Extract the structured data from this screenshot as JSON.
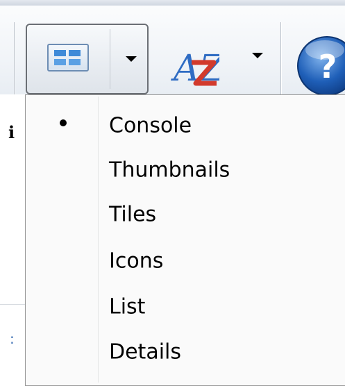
{
  "toolbar": {
    "view_button": {
      "icon": "views-icon",
      "arrow_icon": "chevron-down-icon"
    },
    "sort_button": {
      "icon": "sort-az-icon",
      "icon_text": "AZ",
      "arrow_icon": "chevron-down-icon"
    },
    "help_button": {
      "icon": "help-icon",
      "icon_text": "?"
    }
  },
  "background": {
    "partial_text_1": "i",
    "partial_text_2": ":"
  },
  "view_menu": {
    "selected_index": 0,
    "items": [
      {
        "label": "Console",
        "selected": true
      },
      {
        "label": "Thumbnails",
        "selected": false
      },
      {
        "label": "Tiles",
        "selected": false
      },
      {
        "label": "Icons",
        "selected": false
      },
      {
        "label": "List",
        "selected": false
      },
      {
        "label": "Details",
        "selected": false
      }
    ]
  },
  "colors": {
    "help_blue": "#1f5fb8",
    "sort_red": "#d23a2c",
    "sort_blue": "#2f6cc3",
    "views_blue": "#3e8ad8",
    "button_border": "#6b6f75",
    "menu_border": "#979797"
  }
}
